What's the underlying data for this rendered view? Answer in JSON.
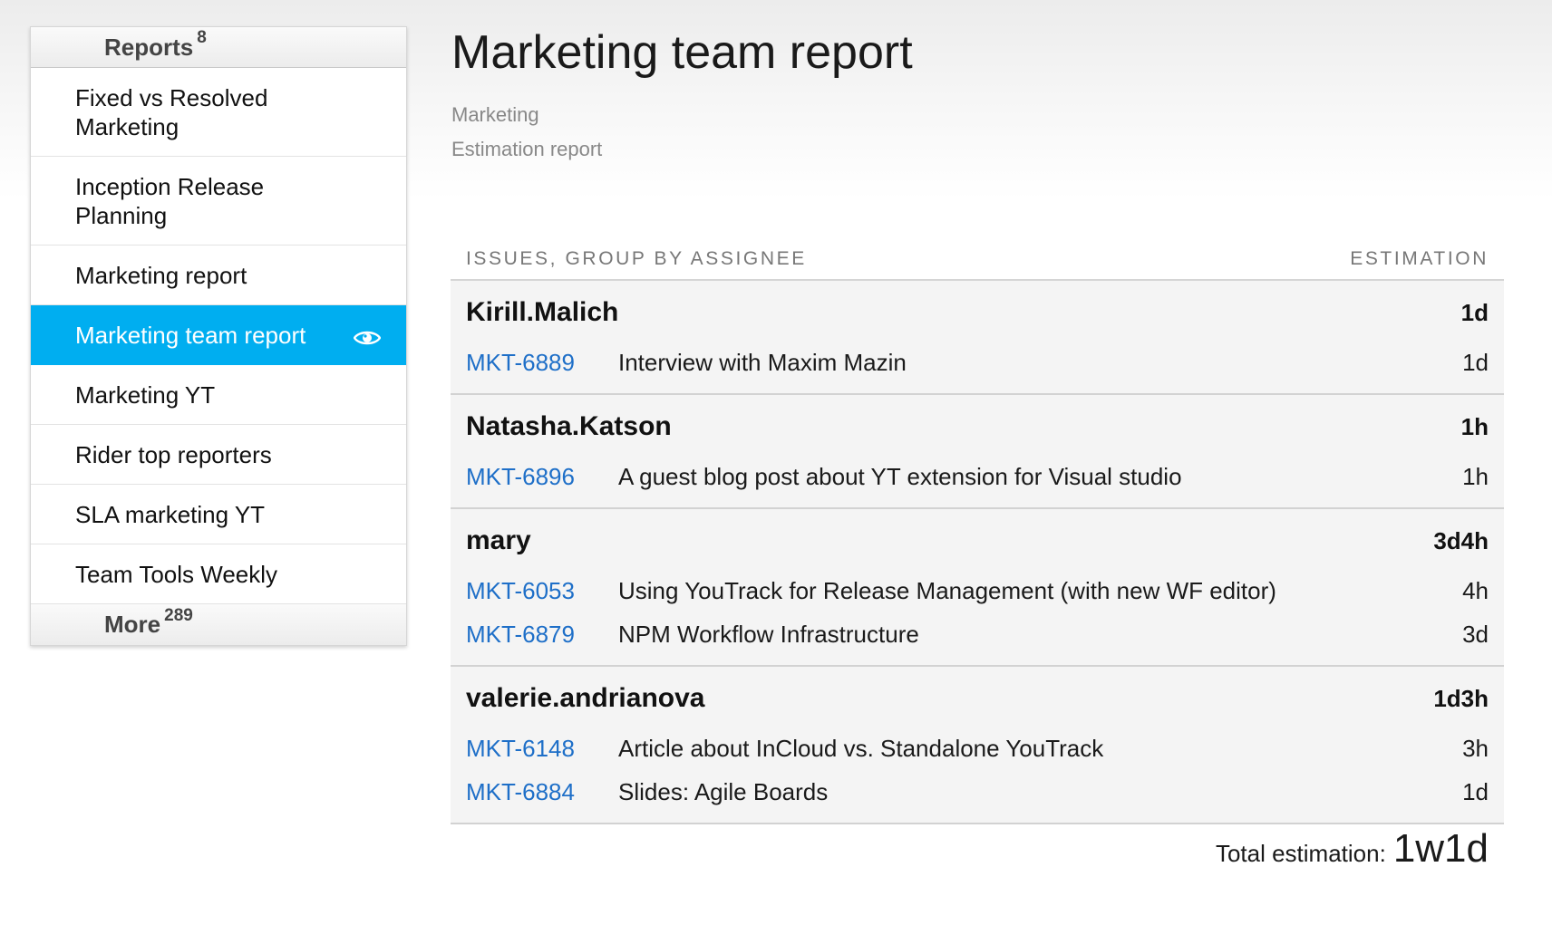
{
  "sidebar": {
    "title": "Reports",
    "count": "8",
    "items": [
      {
        "label": "Fixed vs Resolved Marketing"
      },
      {
        "label": "Inception Release Planning"
      },
      {
        "label": "Marketing report"
      },
      {
        "label": "Marketing team report",
        "active": true,
        "icon": "eye-icon"
      },
      {
        "label": "Marketing YT"
      },
      {
        "label": "Rider top reporters"
      },
      {
        "label": "SLA marketing YT"
      },
      {
        "label": "Team Tools Weekly"
      }
    ],
    "more_label": "More",
    "more_count": "289"
  },
  "report": {
    "title": "Marketing team report",
    "project": "Marketing",
    "type": "Estimation report",
    "column_left": "Issues, group by assignee",
    "column_right": "Estimation",
    "groups": [
      {
        "assignee": "Kirill.Malich",
        "total": "1d",
        "issues": [
          {
            "id": "MKT-6889",
            "summary": "Interview with Maxim Mazin",
            "estimation": "1d"
          }
        ]
      },
      {
        "assignee": "Natasha.Katson",
        "total": "1h",
        "issues": [
          {
            "id": "MKT-6896",
            "summary": "A guest blog post about YT extension for Visual studio",
            "estimation": "1h"
          }
        ]
      },
      {
        "assignee": "mary",
        "total": "3d4h",
        "issues": [
          {
            "id": "MKT-6053",
            "summary": "Using YouTrack for Release Management (with new WF editor)",
            "estimation": "4h"
          },
          {
            "id": "MKT-6879",
            "summary": "NPM Workflow Infrastructure",
            "estimation": "3d"
          }
        ]
      },
      {
        "assignee": "valerie.andrianova",
        "total": "1d3h",
        "issues": [
          {
            "id": "MKT-6148",
            "summary": "Article about InCloud vs. Standalone YouTrack",
            "estimation": "3h"
          },
          {
            "id": "MKT-6884",
            "summary": "Slides: Agile Boards",
            "estimation": "1d"
          }
        ]
      }
    ],
    "total_label": "Total estimation:",
    "total_value": "1w1d"
  },
  "colors": {
    "accent": "#00aef0",
    "link": "#1e6fc8",
    "muted": "#888888"
  }
}
